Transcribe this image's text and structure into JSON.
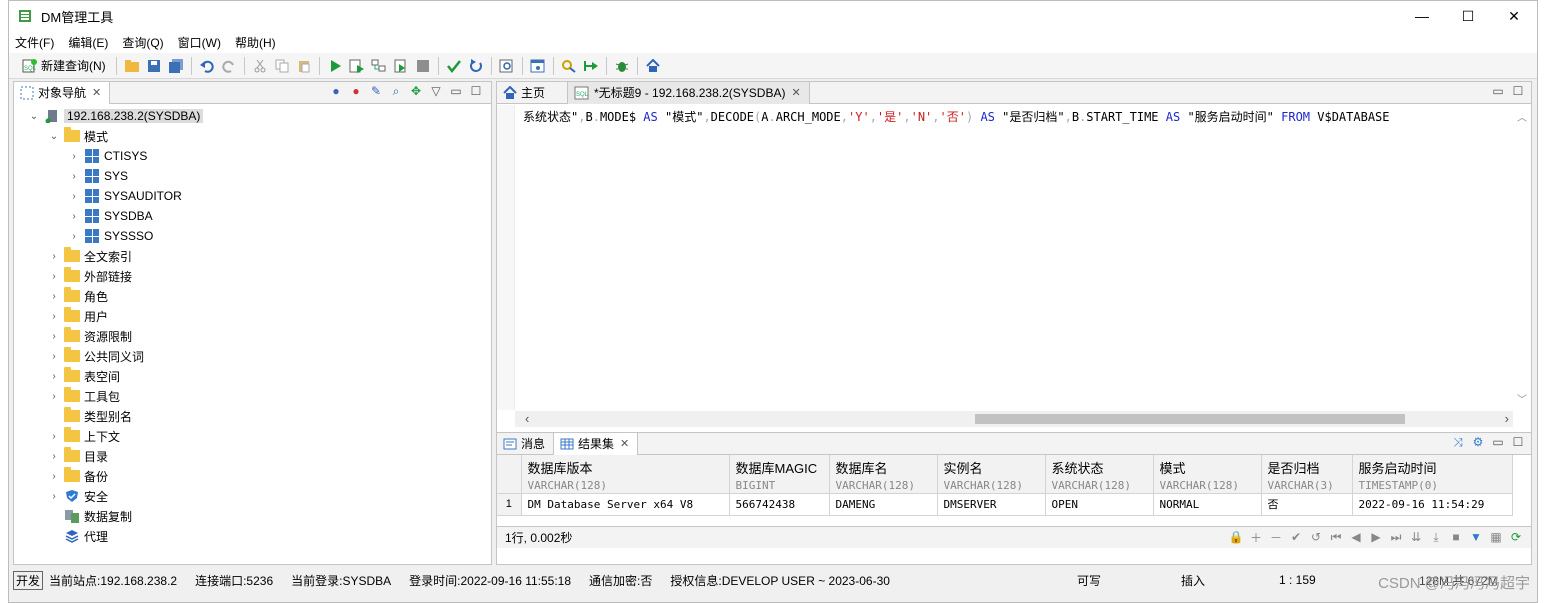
{
  "window": {
    "title": "DM管理工具",
    "controls": [
      "—",
      "☐",
      "✕"
    ]
  },
  "menu": [
    "文件(F)",
    "编辑(E)",
    "查询(Q)",
    "窗口(W)",
    "帮助(H)"
  ],
  "toolbar": {
    "new_query_label": "新建查询(N)"
  },
  "navigator": {
    "tab_label": "对象导航",
    "root": "192.168.238.2(SYSDBA)",
    "schema_folder": "模式",
    "schemas": [
      "CTISYS",
      "SYS",
      "SYSAUDITOR",
      "SYSDBA",
      "SYSSSO"
    ],
    "folders": [
      "全文索引",
      "外部链接",
      "角色",
      "用户",
      "资源限制",
      "公共同义词",
      "表空间",
      "工具包",
      "类型别名",
      "上下文",
      "目录",
      "备份",
      "安全",
      "数据复制",
      "代理"
    ]
  },
  "editor": {
    "tabs": [
      {
        "label": "主页"
      },
      {
        "label": "*无标题9 - 192.168.238.2(SYSDBA)"
      }
    ],
    "code_tokens": [
      {
        "t": "系统状态\"",
        "c": "txt"
      },
      {
        "t": ",",
        "c": "dot"
      },
      {
        "t": "B",
        "c": "txt"
      },
      {
        "t": ".",
        "c": "dot"
      },
      {
        "t": "MODE$ ",
        "c": "txt"
      },
      {
        "t": "AS",
        "c": "kw"
      },
      {
        "t": " \"模式\"",
        "c": "txt"
      },
      {
        "t": ",",
        "c": "dot"
      },
      {
        "t": "DECODE",
        "c": "txt"
      },
      {
        "t": "(",
        "c": "dot"
      },
      {
        "t": "A",
        "c": "txt"
      },
      {
        "t": ".",
        "c": "dot"
      },
      {
        "t": "ARCH_MODE",
        "c": "txt"
      },
      {
        "t": ",",
        "c": "dot"
      },
      {
        "t": "'Y'",
        "c": "str"
      },
      {
        "t": ",",
        "c": "dot"
      },
      {
        "t": "'是'",
        "c": "str"
      },
      {
        "t": ",",
        "c": "dot"
      },
      {
        "t": "'N'",
        "c": "str"
      },
      {
        "t": ",",
        "c": "dot"
      },
      {
        "t": "'否'",
        "c": "str"
      },
      {
        "t": ") ",
        "c": "dot"
      },
      {
        "t": "AS",
        "c": "kw"
      },
      {
        "t": " \"是否归档\"",
        "c": "txt"
      },
      {
        "t": ",",
        "c": "dot"
      },
      {
        "t": "B",
        "c": "txt"
      },
      {
        "t": ".",
        "c": "dot"
      },
      {
        "t": "START_TIME ",
        "c": "txt"
      },
      {
        "t": "AS",
        "c": "kw"
      },
      {
        "t": " \"服务启动时间\" ",
        "c": "txt"
      },
      {
        "t": "FROM",
        "c": "kw"
      },
      {
        "t": " V$DATABASE",
        "c": "txt"
      }
    ]
  },
  "results": {
    "tabs": [
      {
        "label": "消息"
      },
      {
        "label": "结果集"
      }
    ],
    "columns": [
      {
        "name": "数据库版本",
        "type": "VARCHAR(128)"
      },
      {
        "name": "数据库MAGIC",
        "type": "BIGINT"
      },
      {
        "name": "数据库名",
        "type": "VARCHAR(128)"
      },
      {
        "name": "实例名",
        "type": "VARCHAR(128)"
      },
      {
        "name": "系统状态",
        "type": "VARCHAR(128)"
      },
      {
        "name": "模式",
        "type": "VARCHAR(128)"
      },
      {
        "name": "是否归档",
        "type": "VARCHAR(3)"
      },
      {
        "name": "服务启动时间",
        "type": "TIMESTAMP(0)"
      }
    ],
    "rows": [
      {
        "num": "1",
        "cells": [
          "DM Database Server x64 V8",
          "566742438",
          "DAMENG",
          "DMSERVER",
          "OPEN",
          "NORMAL",
          "否",
          "2022-09-16 11:54:29"
        ]
      }
    ],
    "status": "1行, 0.002秒"
  },
  "statusbar": {
    "mode": "开发",
    "site": "当前站点:192.168.238.2",
    "port": "连接端口:5236",
    "login": "当前登录:SYSDBA",
    "login_time": "登录时间:2022-09-16 11:55:18",
    "encrypt": "通信加密:否",
    "license": "授权信息:DEVELOP USER ~ 2023-06-30",
    "writable": "可写",
    "insert": "插入",
    "cursor": "1 : 159",
    "memory": "128M 共 672M"
  },
  "watermark": "CSDN @冯冯冯冯超宇",
  "colors": {
    "keyword": "#1d27c9",
    "string": "#c81e1e",
    "folder": "#f4c542",
    "schema": "#3b78c4"
  }
}
